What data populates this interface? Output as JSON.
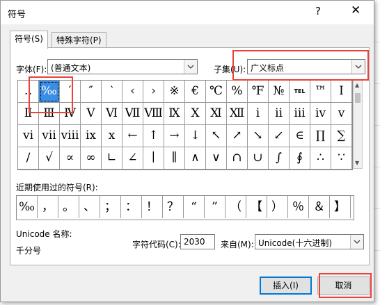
{
  "window": {
    "title": "符号",
    "help": "?",
    "close": "✕"
  },
  "tabs": [
    {
      "label": "符号(S)"
    },
    {
      "label": "特殊字符(P)"
    }
  ],
  "font": {
    "label": "字体(F):",
    "value": "(普通文本)"
  },
  "subset": {
    "label": "子集(U):",
    "value": "广义标点"
  },
  "symbols": [
    [
      "‥",
      "‰",
      "′",
      "″",
      "‵",
      "‹",
      "›",
      "※",
      "€",
      "℃",
      "%",
      "℉",
      "№",
      "TEL",
      "™",
      "Ⅰ"
    ],
    [
      "Ⅱ",
      "Ⅲ",
      "Ⅳ",
      "Ⅴ",
      "Ⅵ",
      "Ⅶ",
      "Ⅷ",
      "Ⅸ",
      "Ⅹ",
      "Ⅺ",
      "Ⅻ",
      "ⅰ",
      "ⅱ",
      "ⅲ",
      "ⅳ",
      "ⅴ"
    ],
    [
      "ⅵ",
      "ⅶ",
      "ⅷ",
      "ⅸ",
      "ⅹ",
      "←",
      "↑",
      "→",
      "↓",
      "↖",
      "↗",
      "↘",
      "↙",
      "∈",
      "∏",
      "∑"
    ],
    [
      "∕",
      "√",
      "∝",
      "∞",
      "∟",
      "∠",
      "∣",
      "∥",
      "∧",
      "∨",
      "∩",
      "∪",
      "∫",
      "∮",
      "∴",
      "∵"
    ]
  ],
  "selected": {
    "row": 0,
    "col": 1
  },
  "recent": {
    "label": "近期使用过的符号(R):",
    "items": [
      "‰",
      "，",
      "。",
      "、",
      "；",
      "：",
      "！",
      "？",
      "“",
      "”",
      "（",
      "【",
      "）",
      "％",
      "＆",
      "】"
    ]
  },
  "unicode_name": {
    "label": "Unicode 名称:",
    "value": "千分号"
  },
  "char_code": {
    "label": "字符代码(C):",
    "value": "2030"
  },
  "from": {
    "label": "来自(M):",
    "value": "Unicode(十六进制)"
  },
  "buttons": {
    "insert": "插入(I)",
    "cancel": "取消"
  },
  "highlight_color": "#e8423a",
  "selection_color": "#3b8ee6"
}
